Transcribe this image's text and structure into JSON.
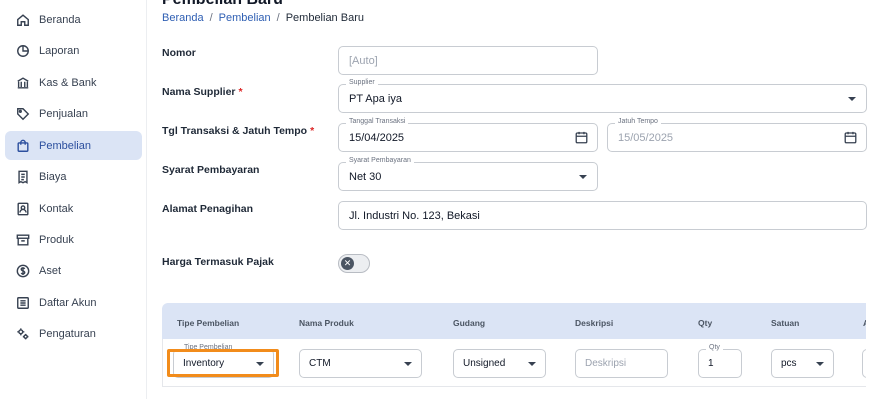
{
  "sidebar": {
    "items": [
      {
        "label": "Beranda",
        "icon": "home-icon",
        "active": false
      },
      {
        "label": "Laporan",
        "icon": "pie-chart-icon",
        "active": false
      },
      {
        "label": "Kas & Bank",
        "icon": "bank-icon",
        "active": false
      },
      {
        "label": "Penjualan",
        "icon": "tag-icon",
        "active": false
      },
      {
        "label": "Pembelian",
        "icon": "shopping-bag-icon",
        "active": true
      },
      {
        "label": "Biaya",
        "icon": "receipt-icon",
        "active": false
      },
      {
        "label": "Kontak",
        "icon": "contact-book-icon",
        "active": false
      },
      {
        "label": "Produk",
        "icon": "archive-box-icon",
        "active": false
      },
      {
        "label": "Aset",
        "icon": "dollar-circle-icon",
        "active": false
      },
      {
        "label": "Daftar Akun",
        "icon": "list-icon",
        "active": false
      },
      {
        "label": "Pengaturan",
        "icon": "gears-icon",
        "active": false
      }
    ]
  },
  "header": {
    "title": "Pembelian Baru",
    "breadcrumb": {
      "home": "Beranda",
      "sep": "/",
      "section": "Pembelian",
      "current": "Pembelian Baru"
    }
  },
  "form": {
    "nomor": {
      "label": "Nomor",
      "placeholder": "[Auto]"
    },
    "supplier": {
      "label": "Nama Supplier",
      "float": "Supplier",
      "value": "PT Apa iya"
    },
    "tanggal": {
      "label": "Tgl Transaksi & Jatuh Tempo",
      "float": "Tanggal Transaksi",
      "value": "15/04/2025",
      "due_float": "Jatuh Tempo",
      "due_value": "15/05/2025"
    },
    "syarat": {
      "label": "Syarat Pembayaran",
      "float": "Syarat Pembayaran",
      "value": "Net 30"
    },
    "alamat": {
      "label": "Alamat Penagihan",
      "value": "Jl. Industri No. 123, Bekasi"
    },
    "pajak": {
      "label": "Harga Termasuk Pajak",
      "enabled": false
    },
    "required_mark": "*"
  },
  "table": {
    "headers": [
      "Tipe Pembelian",
      "Nama Produk",
      "Gudang",
      "Deskripsi",
      "Qty",
      "Satuan",
      "A"
    ],
    "row": {
      "tipe_float": "Tipe Pembelian",
      "tipe": "Inventory",
      "produk": "CTM",
      "gudang": "Unsigned",
      "deskripsi_placeholder": "Deskripsi",
      "qty_float": "Qty",
      "qty": "1",
      "satuan": "pcs"
    }
  },
  "colors": {
    "accent": "#2f5fb3",
    "active_bg": "#dbe4f5",
    "highlight": "#f28c1b",
    "required": "#dc2626"
  }
}
